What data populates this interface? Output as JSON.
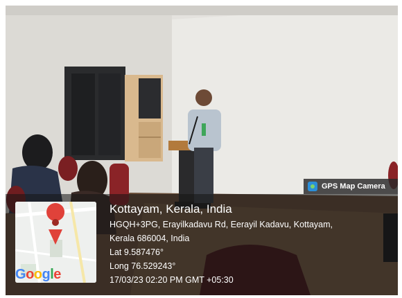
{
  "badge": {
    "label": "GPS Map Camera",
    "icon": "gps-map-camera-icon"
  },
  "location": {
    "city": "Kottayam, Kerala, India",
    "address_line1": "HGQH+3PG, Erayilkadavu Rd, Eerayil Kadavu, Kottayam,",
    "address_line2": "Kerala 686004, India",
    "latitude": "Lat 9.587476°",
    "longitude": "Long 76.529243°",
    "timestamp": "17/03/23 02:20 PM GMT +05:30"
  },
  "map": {
    "logo": "Google",
    "pin_color": "#e0423a"
  }
}
